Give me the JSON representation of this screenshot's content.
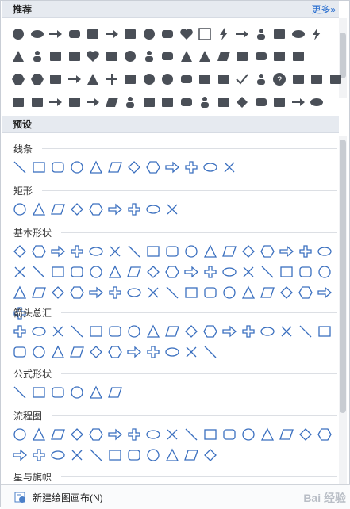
{
  "recommended": {
    "title": "推荐",
    "more_label": "更多»",
    "rows": [
      [
        "circle-fill-icon",
        "cloud-fill-icon",
        "tag-arrow-icon",
        "rounded-rect-icon",
        "callout-icon",
        "diagonal-arrow-icon",
        "speech-bubble-icon",
        "circle-icon",
        "rounded-square-icon",
        "heart-icon",
        "square-outline-icon",
        "lightning-icon",
        "dashed-arrow-icon",
        "people-icon",
        "map-pin-icon",
        "ellipse-icon",
        "lightning-bolt-icon"
      ],
      [
        "triangle-icon",
        "crowd-icon",
        "globe-icon",
        "phone-icon",
        "heart-outline-icon",
        "rectangle-icon",
        "donut-icon",
        "person-icon",
        "rounded-rect-small-icon",
        "triangle-small-icon",
        "triangle-outline-icon",
        "parallelogram-icon",
        "square-small-icon",
        "rounded-square-small-icon",
        "book-icon",
        "sun-icon"
      ],
      [
        "hexagon-icon",
        "octagon-icon",
        "monitor-icon",
        "arrow-right-icon",
        "triangle-up-icon",
        "plus-icon",
        "money-bag-icon",
        "circle-dotted-icon",
        "dot-icon",
        "rounded-square-alt-icon",
        "curly-brace-icon",
        "location-icon",
        "check-icon",
        "group-icon",
        "question-icon",
        "crosshair-icon",
        "mobile-icon",
        "chart-icon"
      ],
      [
        "folded-corner-icon",
        "corner-icon",
        "thin-arrow-icon",
        "trend-icon",
        "arrow-right-alt-icon",
        "tilted-square-icon",
        "team-icon",
        "square-fill-icon",
        "square-fill-alt-icon",
        "rounded-square-fill-icon",
        "person-add-icon",
        "hand-icon",
        "diamond-icon",
        "rounded-rect-fill-icon",
        "money-icon",
        "arrow-long-icon",
        "cloud-hill-icon"
      ]
    ]
  },
  "presets": {
    "title": "预设",
    "categories": [
      {
        "label": "线条",
        "count": 12
      },
      {
        "label": "矩形",
        "count": 9
      },
      {
        "label": "基本形状",
        "count": 52
      },
      {
        "label": "箭头总汇",
        "count": 28
      },
      {
        "label": "公式形状",
        "count": 6
      },
      {
        "label": "流程图",
        "count": 28
      },
      {
        "label": "星与旗帜",
        "count": 0
      }
    ]
  },
  "footer": {
    "new_canvas_label": "新建绘图画布(N)"
  },
  "watermark": "Bai 经验"
}
